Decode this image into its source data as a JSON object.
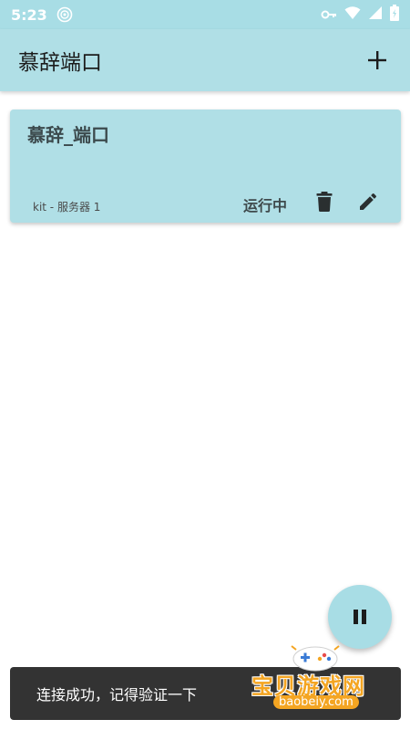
{
  "status_bar": {
    "time": "5:23",
    "icons": [
      "notification-icon",
      "vpn-key-icon",
      "wifi-icon",
      "signal-icon",
      "battery-icon"
    ]
  },
  "app_bar": {
    "title": "慕辞端口",
    "add_icon": "plus-icon"
  },
  "port_card": {
    "title": "慕辞_端口",
    "subtitle": "kit - 服务器 1",
    "status": "运行中",
    "delete_icon": "trash-icon",
    "edit_icon": "pencil-icon"
  },
  "fab": {
    "icon": "pause-icon"
  },
  "snackbar": {
    "message": "连接成功，记得验证一下"
  },
  "watermark": {
    "main": "宝贝游戏网",
    "sub": "baobeiy.com"
  },
  "colors": {
    "accent": "#b0dfe6",
    "status_bar": "#a8dde5",
    "snackbar": "#333333",
    "watermark": "#f4a522"
  }
}
